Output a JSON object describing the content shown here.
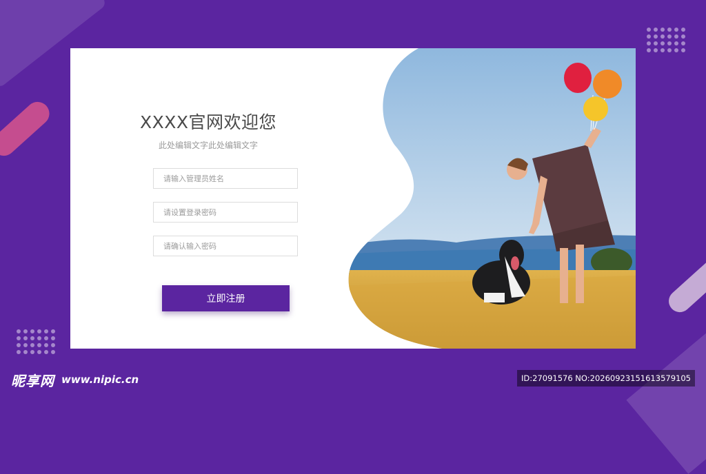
{
  "form": {
    "title": "XXXX官网欢迎您",
    "subtitle": "此处编辑文字此处编辑文字",
    "username_placeholder": "请输入管理员姓名",
    "password_placeholder": "请设置登录密码",
    "confirm_placeholder": "请确认输入密码",
    "submit_label": "立即注册"
  },
  "watermark": {
    "logo": "昵享网",
    "url": "www.nipic.cn",
    "id_text": "ID:27091576 NO:20260923151613579105"
  },
  "colors": {
    "brand_purple": "#5b25a0",
    "card_bg": "#ffffff",
    "accent_pink": "#d8558c"
  },
  "icons": [
    "decorative-dots",
    "decorative-pill",
    "balloon",
    "dog"
  ]
}
